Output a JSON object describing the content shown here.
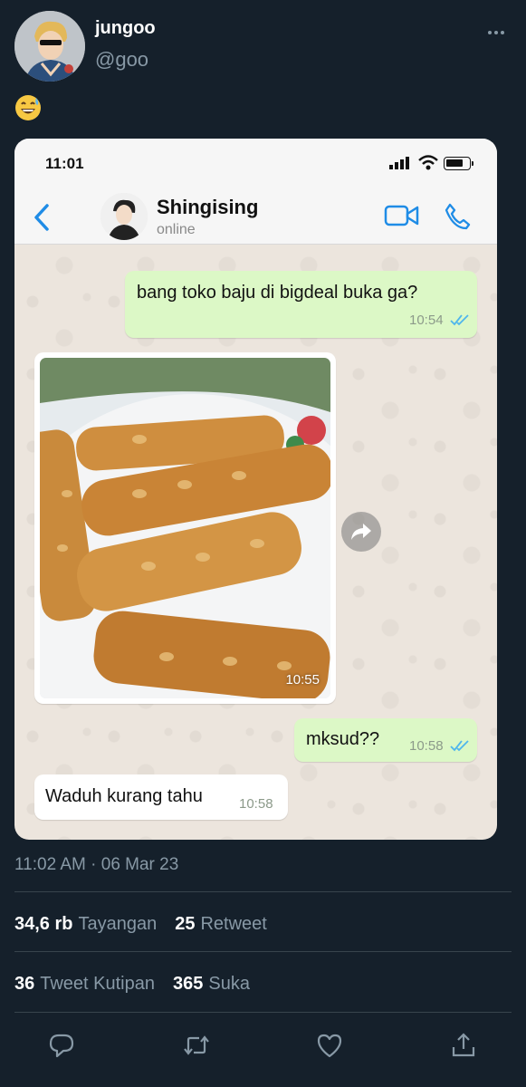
{
  "tweet": {
    "display_name": "jungoo",
    "handle": "@goo",
    "emoji_name": "grinning-sweat-emoji",
    "timestamp": "11:02 AM · 06 Mar 23",
    "stats": [
      {
        "number": "34,6 rb",
        "label": "Tayangan"
      },
      {
        "number": "25",
        "label": "Retweet"
      },
      {
        "number": "36",
        "label": "Tweet Kutipan"
      },
      {
        "number": "365",
        "label": "Suka"
      }
    ],
    "actions": [
      "reply-icon",
      "retweet-icon",
      "like-icon",
      "share-icon"
    ]
  },
  "screenshot": {
    "status_time": "11:01",
    "contact_name": "Shingising",
    "contact_status": "online",
    "messages": [
      {
        "direction": "out",
        "text": "bang toko baju di bigdeal buka ga?",
        "time": "10:54",
        "read": true
      },
      {
        "direction": "in",
        "type": "image",
        "image_desc": "tempeh-photo",
        "time": "10:55"
      },
      {
        "direction": "out",
        "text": "mksud??",
        "time": "10:58",
        "read": true
      },
      {
        "direction": "in",
        "text": "Waduh kurang tahu",
        "time": "10:58"
      }
    ]
  },
  "colors": {
    "background": "#15202b",
    "muted": "#8899a6",
    "divider": "#38444d",
    "wa_outgoing": "#dcf8c6",
    "wa_accent": "#1f8ce6",
    "read_ticks": "#4fb6ec"
  }
}
